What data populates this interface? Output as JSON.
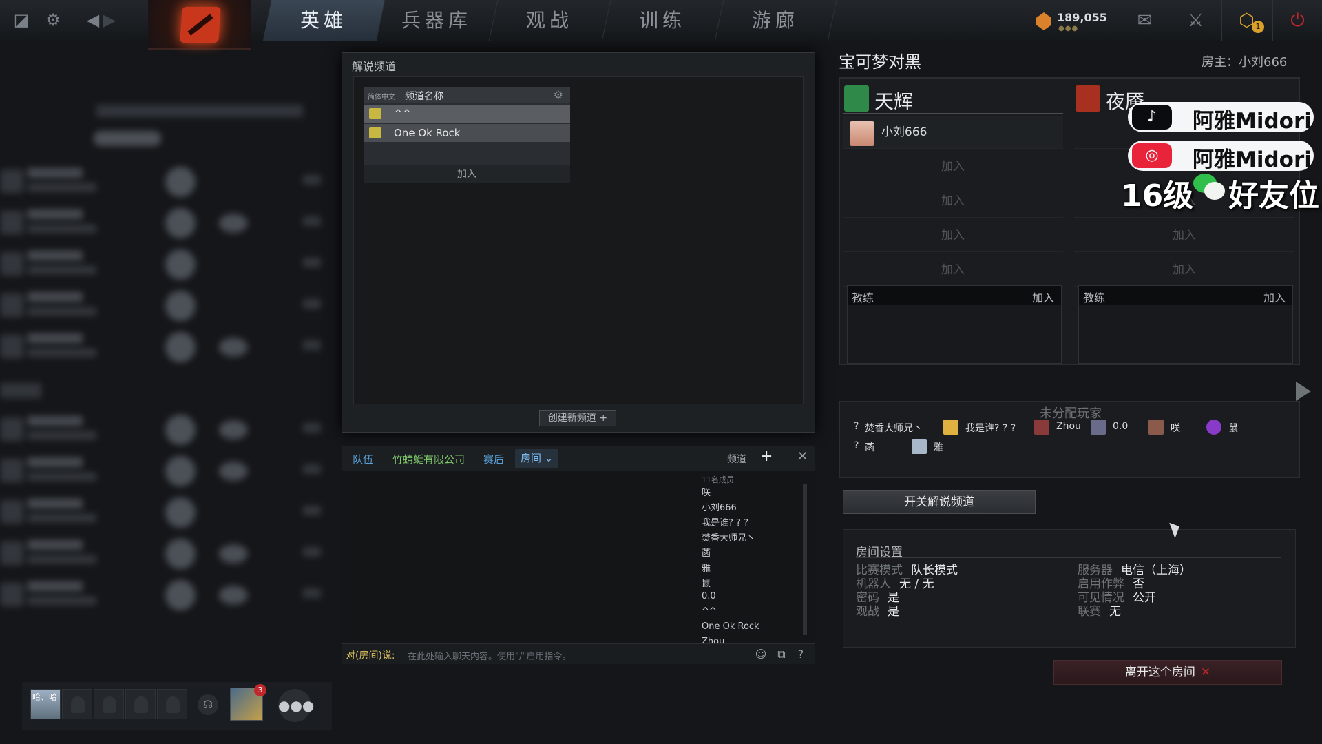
{
  "topbar": {
    "nav_tabs": [
      {
        "label": "英雄",
        "active": true
      },
      {
        "label": "兵器库",
        "active": false
      },
      {
        "label": "观战",
        "active": false
      },
      {
        "label": "训练",
        "active": false
      },
      {
        "label": "游廊",
        "active": false
      }
    ],
    "gold_amount": "189,055",
    "notification_count": "1",
    "icons": [
      "dota-icon",
      "gear-icon",
      "back-icon",
      "forward-icon",
      "mail-icon",
      "armory-icon",
      "plus-shard-icon",
      "power-icon"
    ]
  },
  "party": {
    "my_avatar_text": "哈、哈",
    "hero_badge_count": "3"
  },
  "channel_dialog": {
    "title": "解说频道",
    "language": "简体中文",
    "column_name": "频道名称",
    "channels": [
      "^^",
      "One Ok Rock"
    ],
    "join_label": "加入",
    "create_button": "创建新频道",
    "create_plus": "+"
  },
  "chat": {
    "tabs": [
      "队伍",
      "竹蜻蜓有限公司",
      "赛后"
    ],
    "active_tab": "房间",
    "channel_label": "频道",
    "member_count": "11名成员",
    "members": [
      "咲",
      "小刘666",
      "我是谁? ? ?",
      "焚香大师兄丶",
      "菡",
      "雅",
      "鼠",
      "0.0",
      "^^",
      "One Ok Rock",
      "Zhou"
    ],
    "input_label": "对(房间)说:",
    "input_placeholder": "在此处输入聊天内容。使用\"/\"启用指令。"
  },
  "lobby": {
    "title": "宝可梦对黑",
    "host": "房主：小刘666",
    "radiant": {
      "name": "天辉",
      "color": "#2f8a4a",
      "players": [
        "小刘666"
      ],
      "join_slots": [
        "加入",
        "加入",
        "加入",
        "加入"
      ]
    },
    "dire": {
      "name": "夜魇",
      "color": "#a8301e",
      "join_slots": [
        "加入",
        "加入",
        "加入",
        "加入"
      ]
    },
    "coach_label": "教练",
    "coach_join": "加入",
    "unassigned_title": "未分配玩家",
    "unassigned": [
      "焚香大师兄丶",
      "我是谁? ? ?",
      "Zhou",
      "0.0",
      "咲",
      "鼠",
      "菡",
      "雅"
    ],
    "broadcast_button": "开关解说频道",
    "settings": {
      "title": "房间设置",
      "rows": [
        {
          "k": "比赛模式",
          "v": "队长模式"
        },
        {
          "k": "机器人",
          "v": "无 / 无"
        },
        {
          "k": "密码",
          "v": "是"
        },
        {
          "k": "观战",
          "v": "是"
        },
        {
          "k": "服务器",
          "v": "电信（上海）"
        },
        {
          "k": "启用作弊",
          "v": "否"
        },
        {
          "k": "可见情况",
          "v": "公开"
        },
        {
          "k": "联赛",
          "v": "无"
        }
      ]
    },
    "leave_button": "离开这个房间",
    "leave_x": "✕"
  },
  "overlay": {
    "douyin_name": "阿雅Midori",
    "weibo_name": "阿雅Midori",
    "level_text": "16级",
    "friend_text": "好友位"
  }
}
